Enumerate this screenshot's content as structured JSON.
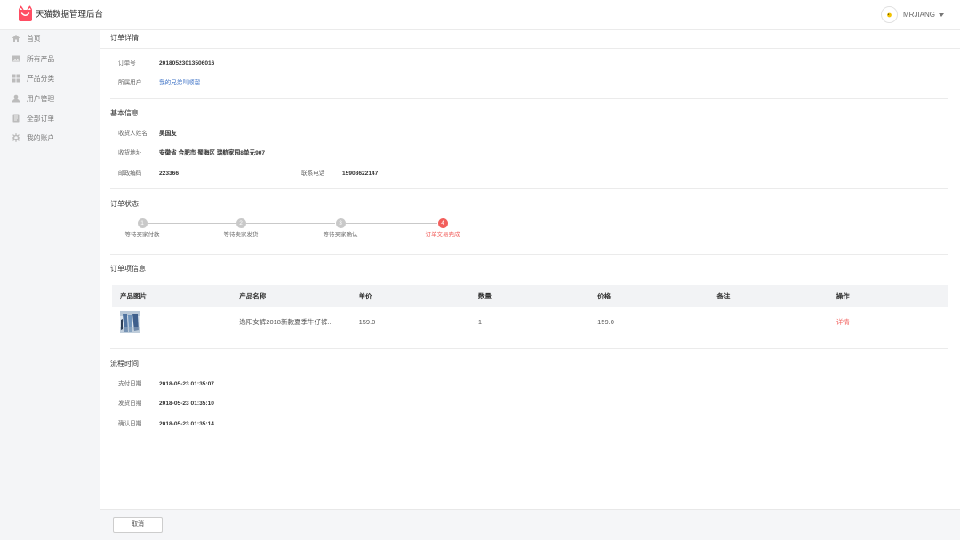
{
  "app": {
    "title": "天猫数据管理后台",
    "logo_icon": "shopping-bag-icon"
  },
  "user_menu": {
    "name": "MRJIANG",
    "avatar_icon": "avatar-icon",
    "caret_icon": "caret-down-icon"
  },
  "sidebar": {
    "items": [
      {
        "label": "首页",
        "icon": "home-icon"
      },
      {
        "label": "所有产品",
        "icon": "image-icon"
      },
      {
        "label": "产品分类",
        "icon": "grid-icon"
      },
      {
        "label": "用户管理",
        "icon": "user-icon"
      },
      {
        "label": "全部订单",
        "icon": "document-icon"
      },
      {
        "label": "我的账户",
        "icon": "gear-icon"
      }
    ]
  },
  "order_detail": {
    "title": "订单详情",
    "order_no_label": "订单号",
    "order_no": "20180523013506016",
    "owner_label": "所属用户",
    "owner": "我的兄弟叫顺溜"
  },
  "basic_info": {
    "title": "基本信息",
    "receiver_label": "收货人姓名",
    "receiver": "吴国友",
    "address_label": "收货地址",
    "address": "安徽省 合肥市 蜀海区 瑞航家园8单元907",
    "postcode_label": "邮政编码",
    "postcode": "223366",
    "phone_label": "联系电话",
    "phone": "15908622147"
  },
  "order_status": {
    "title": "订单状态",
    "current_step": 4,
    "steps": [
      {
        "number": "1",
        "label": "等待买家付款"
      },
      {
        "number": "2",
        "label": "等待卖家发货"
      },
      {
        "number": "3",
        "label": "等待买家确认"
      },
      {
        "number": "4",
        "label": "订单交易完成"
      }
    ]
  },
  "order_items": {
    "title": "订单项信息",
    "columns": [
      "产品图片",
      "产品名称",
      "单价",
      "数量",
      "价格",
      "备注",
      "操作"
    ],
    "rows": [
      {
        "name": "逸阳女裤2018新款夏季牛仔裤...",
        "unit_price": "159.0",
        "quantity": "1",
        "price": "159.0",
        "note": "",
        "action": "详情"
      }
    ]
  },
  "timeline": {
    "title": "流程时间",
    "entries": [
      {
        "label": "支付日期",
        "value": "2018-05-23 01:35:07"
      },
      {
        "label": "发货日期",
        "value": "2018-05-23 01:35:10"
      },
      {
        "label": "确认日期",
        "value": "2018-05-23 01:35:14"
      }
    ]
  },
  "footer": {
    "cancel_label": "取消"
  },
  "colors": {
    "accent": "#f25f5c",
    "link": "#3d72c6",
    "brand": "#ff4d63",
    "sidebar_bg": "#f4f5f7",
    "table_header_bg": "#f2f3f5",
    "step_inactive": "#c9c9c9",
    "footer_bg": "#f5f6f8"
  }
}
